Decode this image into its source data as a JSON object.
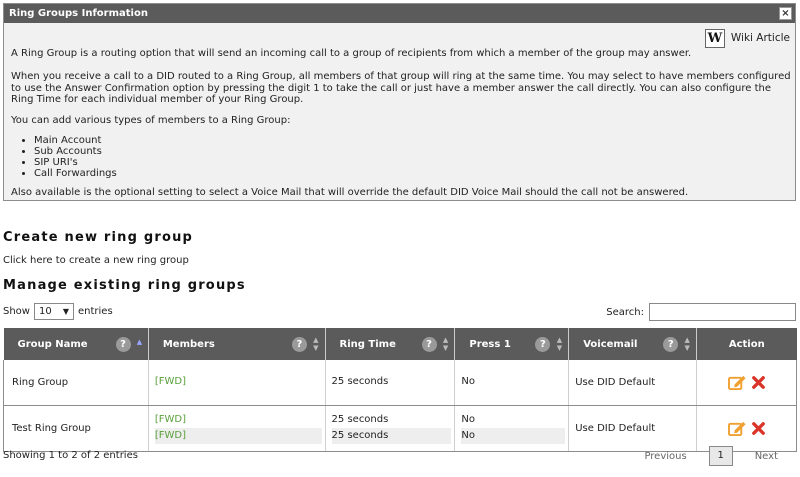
{
  "info": {
    "title": "Ring Groups Information",
    "close_label": "×",
    "wiki_icon_letter": "W",
    "wiki_label": "Wiki Article",
    "p1": "A Ring Group is a routing option that will send an incoming call to a group of recipients from which a member of the group may answer.",
    "p2": "When you receive a call to a DID routed to a Ring Group, all members of that group will ring at the same time. You may select to have members configured to use the Answer Confirmation option by pressing the digit 1 to take the call or just have a member answer the call directly. You can also configure the Ring Time for each individual member of your Ring Group.",
    "p3": "You can add various types of members to a Ring Group:",
    "member_types": [
      "Main Account",
      "Sub Accounts",
      "SIP URI's",
      "Call Forwardings"
    ],
    "p4": "Also available is the optional setting to select a Voice Mail that will override the default DID Voice Mail should the call not be answered."
  },
  "create": {
    "heading": "Create new ring group",
    "link": "Click here to create a new ring group"
  },
  "manage": {
    "heading": "Manage existing ring groups",
    "show_label": "Show",
    "show_value": "10",
    "entries_label": "entries",
    "search_label": "Search:"
  },
  "table": {
    "columns": [
      "Group Name",
      "Members",
      "Ring Time",
      "Press 1",
      "Voicemail",
      "Action"
    ],
    "rows": [
      {
        "group_name": "Ring Group",
        "members": [
          "[FWD]"
        ],
        "ring_times": [
          "25 seconds"
        ],
        "press1": [
          "No"
        ],
        "voicemail": "Use DID Default"
      },
      {
        "group_name": "Test Ring Group",
        "members": [
          "[FWD]",
          "[FWD]"
        ],
        "ring_times": [
          "25 seconds",
          "25 seconds"
        ],
        "press1": [
          "No",
          "No"
        ],
        "voicemail": "Use DID Default"
      }
    ]
  },
  "footer": {
    "info": "Showing 1 to 2 of 2 entries",
    "previous": "Previous",
    "current_page": "1",
    "next": "Next"
  },
  "colors": {
    "header_bg": "#5b5b5b",
    "member_link": "#5aa03a",
    "edit_icon": "#f0a030",
    "delete_icon": "#d9352a"
  }
}
